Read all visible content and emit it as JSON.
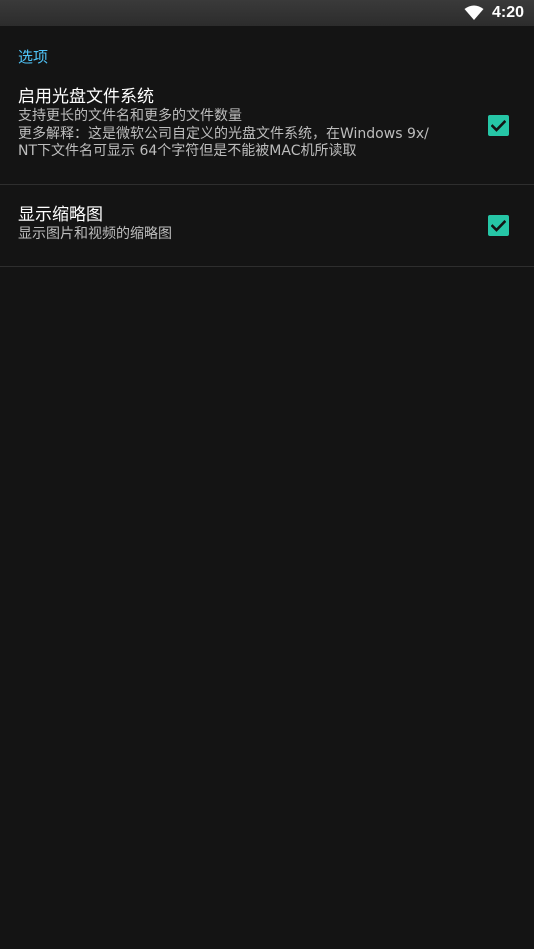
{
  "status_bar": {
    "time": "4:20",
    "wifi_icon": "wifi-icon"
  },
  "options": {
    "category_title": "选项",
    "items": [
      {
        "title": "启用光盘文件系统",
        "summary": "支持更长的文件名和更多的文件数量\n更多解释：这是微软公司自定义的光盘文件系统，在Windows 9x/\nNT下文件名可显示 64个字符但是不能被MAC机所读取",
        "checked": true
      },
      {
        "title": "显示缩略图",
        "summary": "显示图片和视频的缩略图",
        "checked": true
      }
    ]
  },
  "colors": {
    "background": "#141414",
    "accent": "#4fc3f7",
    "checkbox": "#26c6a6"
  }
}
